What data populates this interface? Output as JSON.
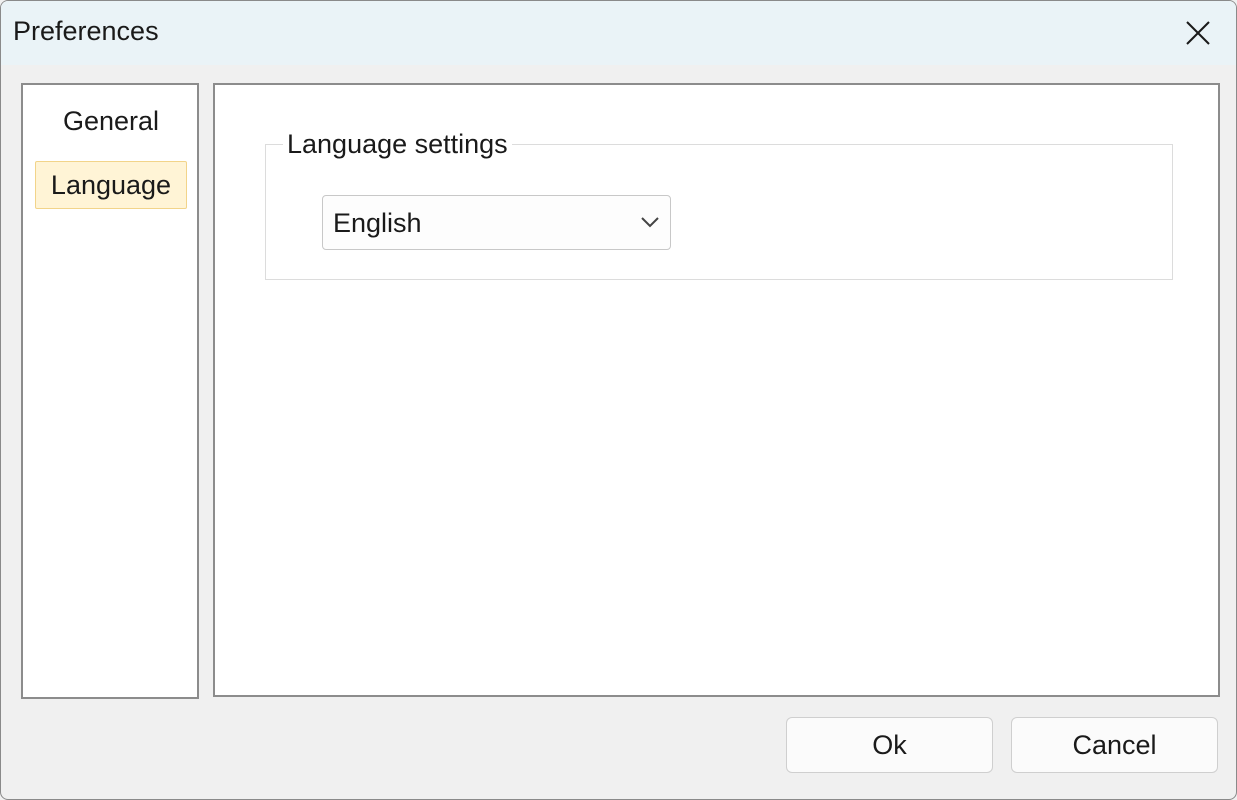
{
  "window": {
    "title": "Preferences",
    "close_icon": "close-icon"
  },
  "sidebar": {
    "items": [
      {
        "label": "General",
        "selected": false
      },
      {
        "label": "Language",
        "selected": true
      }
    ],
    "selected_highlight_color": "#fff4d6"
  },
  "language_section": {
    "group_title": "Language settings",
    "language_select": {
      "value": "English",
      "icon": "chevron-down-icon"
    }
  },
  "footer": {
    "ok_label": "Ok",
    "cancel_label": "Cancel"
  }
}
